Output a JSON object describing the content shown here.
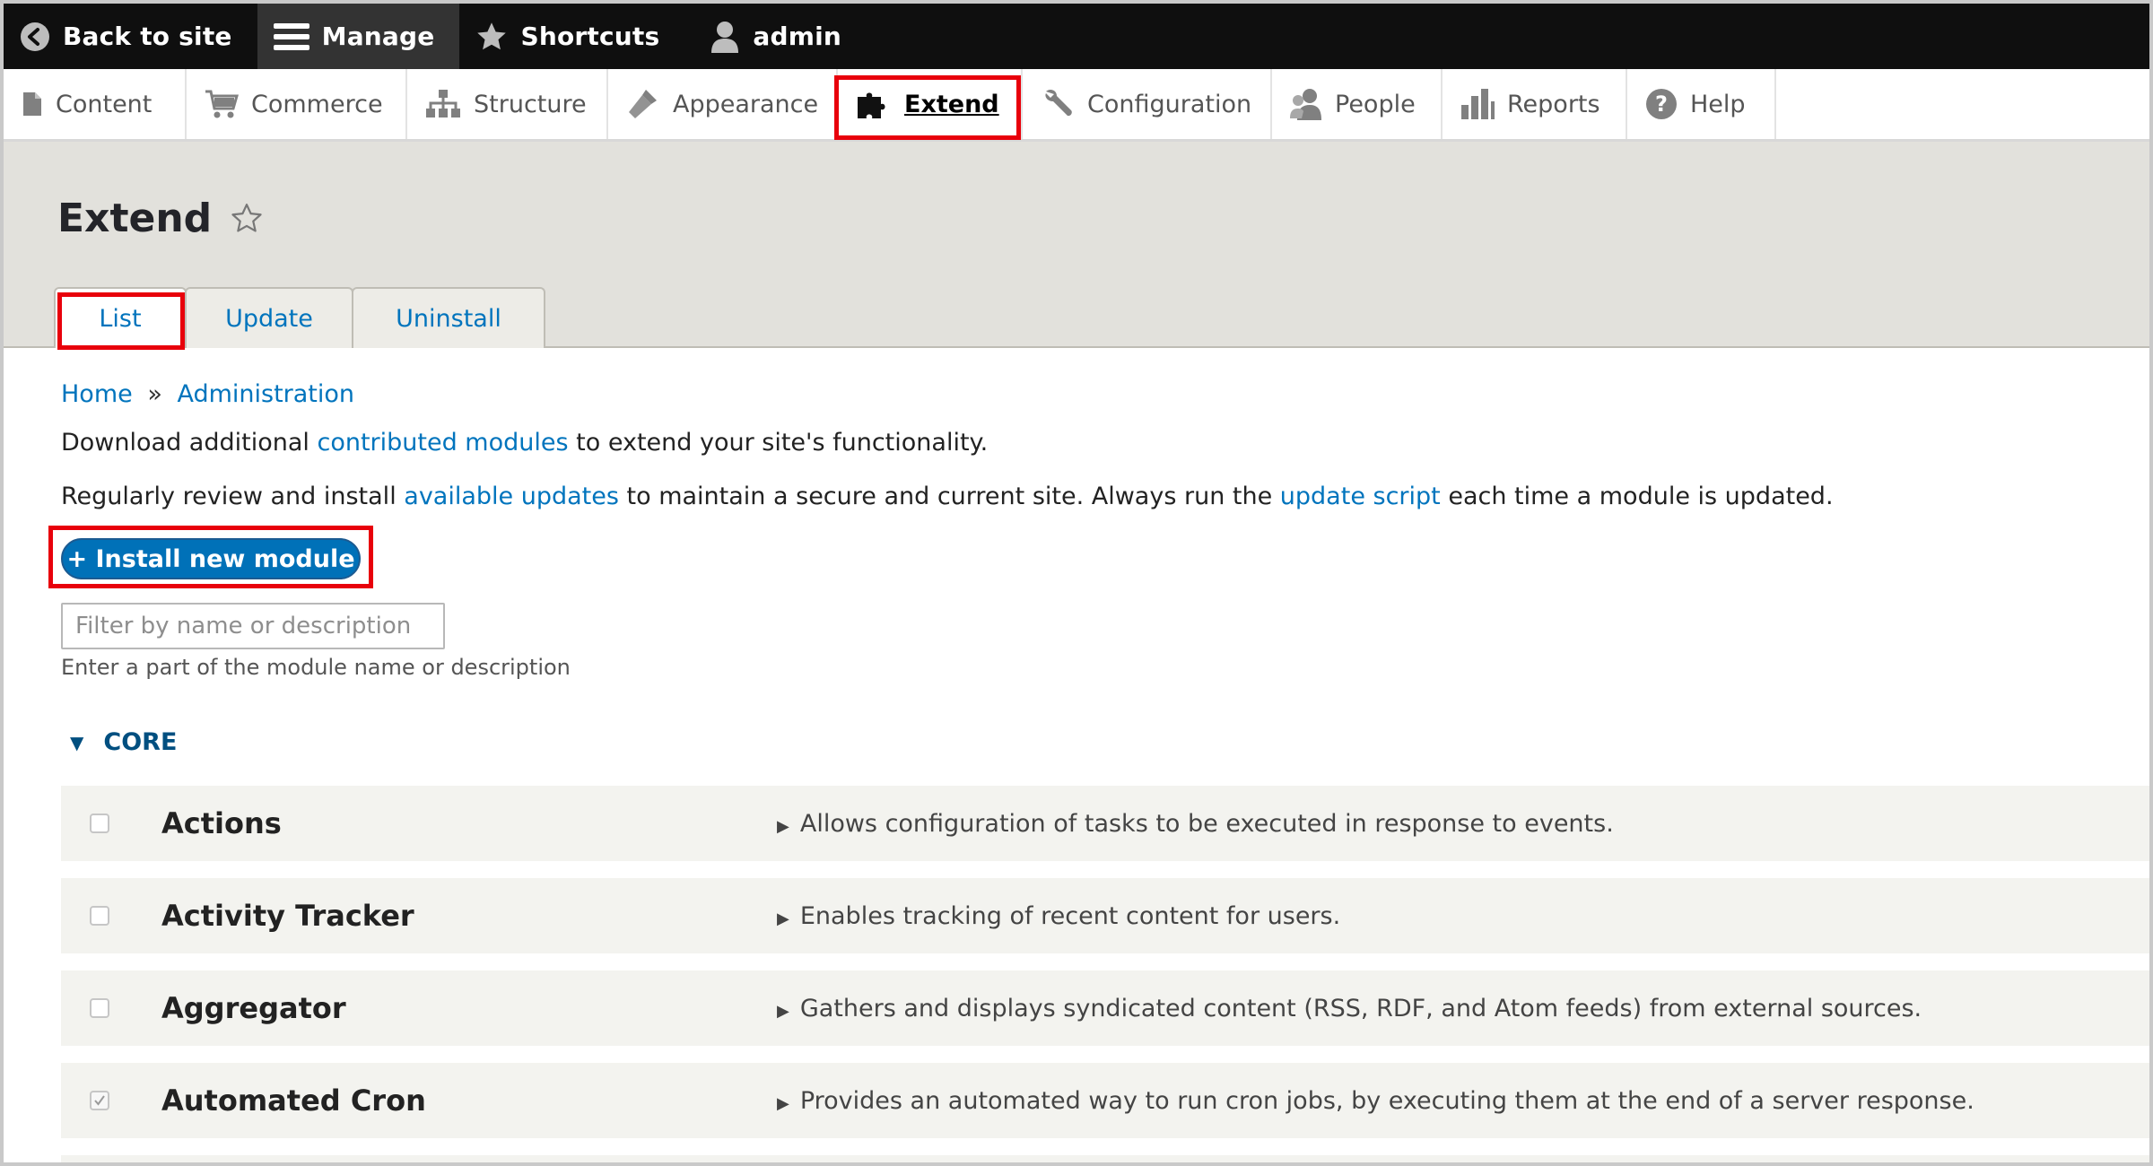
{
  "toolbar": {
    "back_label": "Back to site",
    "manage_label": "Manage",
    "shortcuts_label": "Shortcuts",
    "user_label": "admin"
  },
  "tray": {
    "items": [
      {
        "label": "Content",
        "icon": "document-icon"
      },
      {
        "label": "Commerce",
        "icon": "cart-icon"
      },
      {
        "label": "Structure",
        "icon": "sitemap-icon"
      },
      {
        "label": "Appearance",
        "icon": "paintbrush-icon"
      },
      {
        "label": "Extend",
        "icon": "puzzle-icon",
        "active": true
      },
      {
        "label": "Configuration",
        "icon": "wrench-icon"
      },
      {
        "label": "People",
        "icon": "people-icon"
      },
      {
        "label": "Reports",
        "icon": "bar-chart-icon"
      },
      {
        "label": "Help",
        "icon": "help-icon"
      }
    ]
  },
  "header": {
    "title": "Extend",
    "tabs": [
      {
        "label": "List",
        "active": true
      },
      {
        "label": "Update"
      },
      {
        "label": "Uninstall"
      }
    ]
  },
  "breadcrumb": {
    "home": "Home",
    "sep": "»",
    "admin": "Administration"
  },
  "intro": {
    "line1_pre": "Download additional ",
    "line1_link": "contributed modules",
    "line1_post": " to extend your site's functionality.",
    "line2_pre": "Regularly review and install ",
    "line2_link1": "available updates",
    "line2_mid": " to maintain a secure and current site. Always run the ",
    "line2_link2": "update script",
    "line2_post": " each time a module is updated."
  },
  "install_button": "+ Install new module",
  "filter": {
    "placeholder": "Filter by name or description",
    "description": "Enter a part of the module name or description"
  },
  "core": {
    "heading": "CORE",
    "modules": [
      {
        "name": "Actions",
        "description": "Allows configuration of tasks to be executed in response to events.",
        "checked": false
      },
      {
        "name": "Activity Tracker",
        "description": "Enables tracking of recent content for users.",
        "checked": false
      },
      {
        "name": "Aggregator",
        "description": "Gathers and displays syndicated content (RSS, RDF, and Atom feeds) from external sources.",
        "checked": false
      },
      {
        "name": "Automated Cron",
        "description": "Provides an automated way to run cron jobs, by executing them at the end of a server response.",
        "checked": true
      }
    ]
  },
  "colors": {
    "toolbar_bg": "#0f0f0f",
    "link": "#0074bd",
    "button": "#0071b8",
    "highlight": "#e8000b",
    "header_bg": "#e2e1dc"
  }
}
